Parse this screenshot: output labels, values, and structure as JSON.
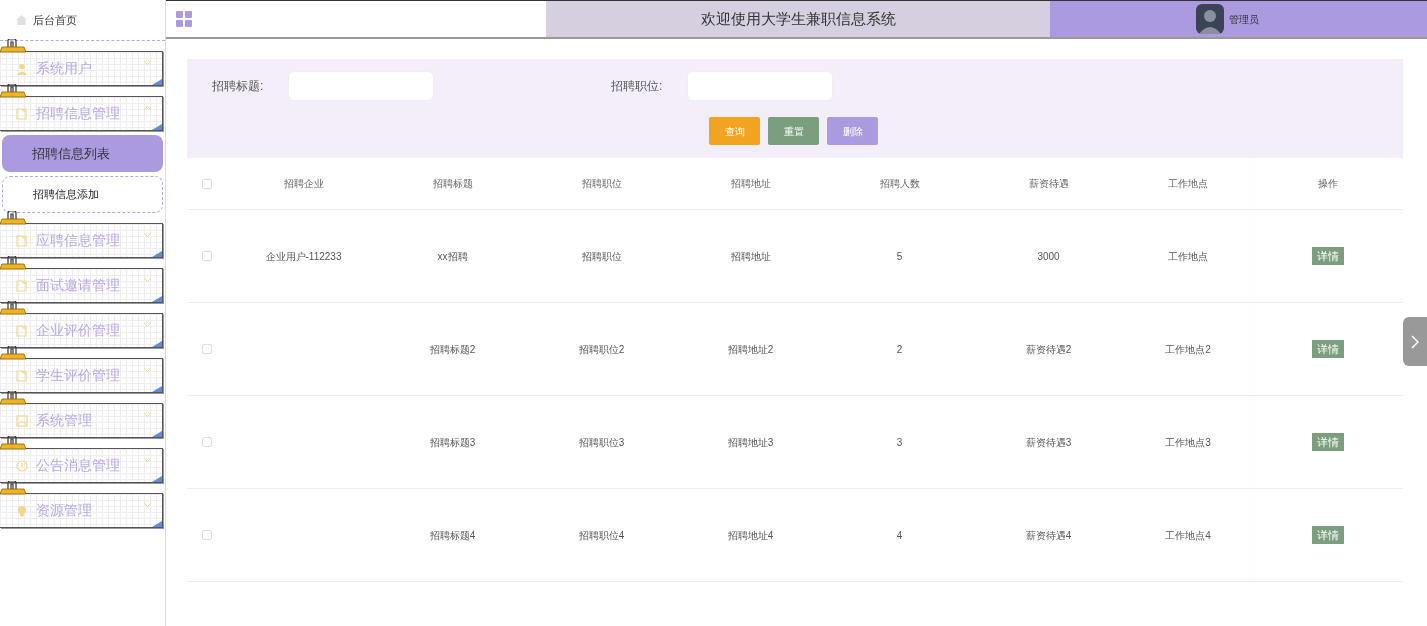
{
  "sidebar": {
    "home": "后台首页",
    "menus": [
      {
        "label": "系统用户",
        "kind": "user",
        "expanded": false
      },
      {
        "label": "招聘信息管理",
        "kind": "doc",
        "expanded": true,
        "children": [
          {
            "label": "招聘信息列表",
            "selected": true
          },
          {
            "label": "招聘信息添加",
            "selected": false
          }
        ]
      },
      {
        "label": "应聘信息管理",
        "kind": "doc",
        "expanded": false
      },
      {
        "label": "面试邀请管理",
        "kind": "doc",
        "expanded": false
      },
      {
        "label": "企业评价管理",
        "kind": "doc",
        "expanded": false
      },
      {
        "label": "学生评价管理",
        "kind": "doc",
        "expanded": false
      },
      {
        "label": "系统管理",
        "kind": "image",
        "expanded": false
      },
      {
        "label": "公告消息管理",
        "kind": "info",
        "expanded": false
      },
      {
        "label": "资源管理",
        "kind": "bulb",
        "expanded": false
      }
    ]
  },
  "header": {
    "title": "欢迎使用大学生兼职信息系统",
    "user": "管理员"
  },
  "search": {
    "fields": [
      {
        "label": "招聘标题:"
      },
      {
        "label": "招聘职位:"
      }
    ],
    "buttons": [
      {
        "label": "查询",
        "kind": "query"
      },
      {
        "label": "重置",
        "kind": "reset"
      },
      {
        "label": "删除",
        "kind": "delete"
      }
    ]
  },
  "table": {
    "all_checked": false,
    "columns": [
      "招聘企业",
      "招聘标题",
      "招聘职位",
      "招聘地址",
      "招聘人数",
      "薪资待遇",
      "工作地点",
      "操作"
    ],
    "rows": [
      {
        "checked": false,
        "cells": [
          "企业用户-112233",
          "xx招聘",
          "招聘职位",
          "招聘地址",
          "5",
          "3000",
          "工作地点"
        ],
        "action": "详情"
      },
      {
        "checked": false,
        "cells": [
          "",
          "招聘标题2",
          "招聘职位2",
          "招聘地址2",
          "2",
          "薪资待遇2",
          "工作地点2"
        ],
        "action": "详情"
      },
      {
        "checked": false,
        "cells": [
          "",
          "招聘标题3",
          "招聘职位3",
          "招聘地址3",
          "3",
          "薪资待遇3",
          "工作地点3"
        ],
        "action": "详情"
      },
      {
        "checked": false,
        "cells": [
          "",
          "招聘标题4",
          "招聘职位4",
          "招聘地址4",
          "4",
          "薪资待遇4",
          "工作地点4"
        ],
        "action": "详情"
      }
    ]
  }
}
